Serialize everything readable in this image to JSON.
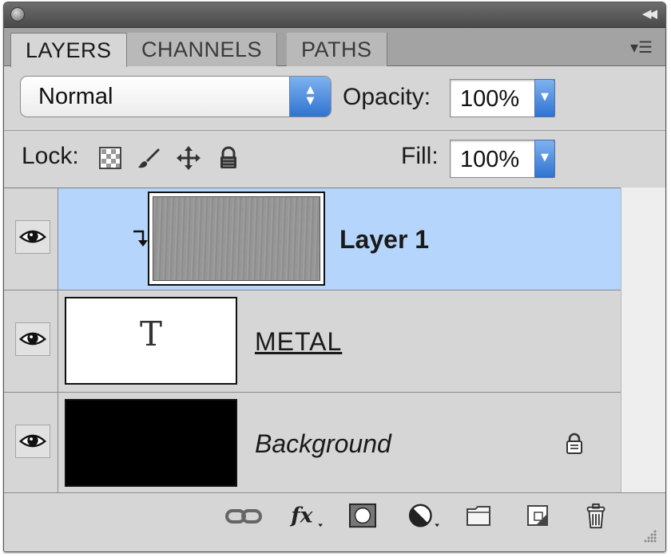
{
  "tabs": [
    {
      "label": "LAYERS",
      "active": true
    },
    {
      "label": "CHANNELS",
      "active": false
    },
    {
      "label": "PATHS",
      "active": false
    }
  ],
  "blend_mode": {
    "value": "Normal"
  },
  "opacity": {
    "label": "Opacity:",
    "value": "100%"
  },
  "lock": {
    "label": "Lock:",
    "icons": [
      "lock-transparent-pixels-icon",
      "lock-image-pixels-icon",
      "lock-position-icon",
      "lock-all-icon"
    ]
  },
  "fill": {
    "label": "Fill:",
    "value": "100%"
  },
  "layers": [
    {
      "name": "Layer 1",
      "selected": true,
      "visible": true,
      "clipping_mask": true,
      "thumbnail": "gray-texture"
    },
    {
      "name": "METAL",
      "selected": false,
      "visible": true,
      "type": "text",
      "thumbnail_glyph": "T"
    },
    {
      "name": "Background",
      "selected": false,
      "visible": true,
      "locked": true,
      "thumbnail": "black-fill"
    }
  ],
  "bottom_icons": [
    "link-layers-icon",
    "layer-style-fx-icon",
    "add-layer-mask-icon",
    "adjustment-layer-icon",
    "new-group-folder-icon",
    "new-layer-icon",
    "delete-layer-trash-icon"
  ],
  "colors": {
    "selection": "#b5d5fc",
    "panel": "#d6d6d6",
    "accent_blue": "#2f73d0"
  }
}
